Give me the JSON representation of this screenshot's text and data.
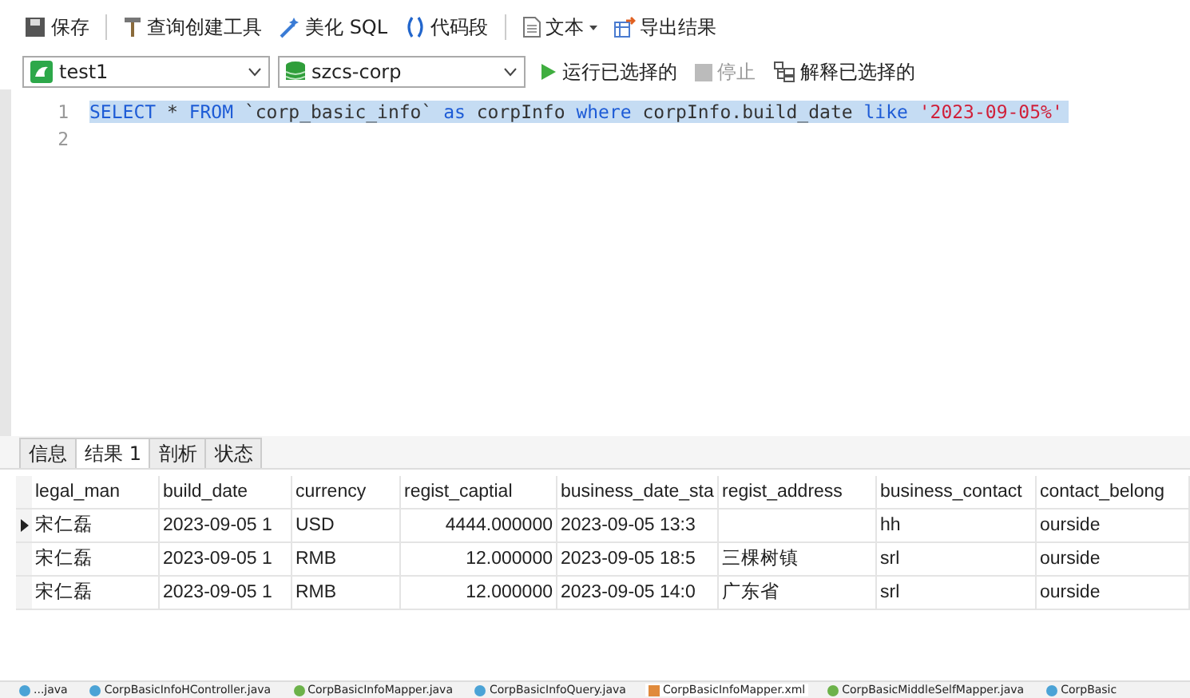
{
  "toolbar": [
    {
      "label": "保存"
    },
    {
      "label": "查询创建工具"
    },
    {
      "label": "美化 SQL"
    },
    {
      "label": "代码段"
    },
    {
      "label": "文本"
    },
    {
      "label": "导出结果"
    }
  ],
  "connection": {
    "value": "test1"
  },
  "database": {
    "value": "szcs-corp"
  },
  "actions": [
    {
      "label": "运行已选择的",
      "disabled": false
    },
    {
      "label": "停止",
      "disabled": true
    },
    {
      "label": "解释已选择的",
      "disabled": false
    }
  ],
  "editor": {
    "lines": [
      {
        "number": "1",
        "selected": true,
        "tokens": [
          {
            "text": "SELECT",
            "kind": "keyword"
          },
          {
            "text": " * ",
            "kind": "plain"
          },
          {
            "text": "FROM",
            "kind": "keyword"
          },
          {
            "text": " `corp_basic_info` ",
            "kind": "plain"
          },
          {
            "text": "as",
            "kind": "keyword"
          },
          {
            "text": " corpInfo ",
            "kind": "plain"
          },
          {
            "text": "where",
            "kind": "keyword"
          },
          {
            "text": " corpInfo.build_date ",
            "kind": "plain"
          },
          {
            "text": "like",
            "kind": "keyword"
          },
          {
            "text": " '2023-09-05%'",
            "kind": "string"
          }
        ]
      },
      {
        "number": "2"
      }
    ]
  },
  "result_tabs": [
    {
      "label": "信息",
      "selected": false
    },
    {
      "label": "结果 1",
      "selected": true
    },
    {
      "label": "剖析",
      "selected": false
    },
    {
      "label": "状态",
      "selected": false
    }
  ],
  "table": {
    "columns": [
      "legal_man",
      "build_date",
      "currency",
      "regist_captial",
      "business_date_sta",
      "regist_address",
      "business_contact",
      "contact_belong"
    ],
    "rows": [
      {
        "current": true,
        "cells": [
          "宋仁磊",
          "2023-09-05 1",
          "USD",
          "4444.000000",
          "2023-09-05 13:3",
          null,
          "hh",
          "ourside"
        ]
      },
      {
        "current": false,
        "cells": [
          "宋仁磊",
          "2023-09-05 1",
          "RMB",
          "12.000000",
          "2023-09-05 18:5",
          "三棵树镇",
          "srl",
          "ourside"
        ]
      },
      {
        "current": false,
        "cells": [
          "宋仁磊",
          "2023-09-05 1",
          "RMB",
          "12.000000",
          "2023-09-05 14:0",
          "广东省",
          "srl",
          "ourside"
        ]
      }
    ]
  },
  "file_tabs": [
    {
      "label": "...java",
      "kind": "class",
      "selected": false
    },
    {
      "label": "CorpBasicInfoHController.java",
      "kind": "class",
      "selected": false
    },
    {
      "label": "CorpBasicInfoMapper.java",
      "kind": "interface",
      "selected": false
    },
    {
      "label": "CorpBasicInfoQuery.java",
      "kind": "class",
      "selected": false
    },
    {
      "label": "CorpBasicInfoMapper.xml",
      "kind": "xml",
      "selected": true
    },
    {
      "label": "CorpBasicMiddleSelfMapper.java",
      "kind": "interface",
      "selected": false
    },
    {
      "label": "CorpBasic",
      "kind": "class",
      "selected": false
    }
  ]
}
